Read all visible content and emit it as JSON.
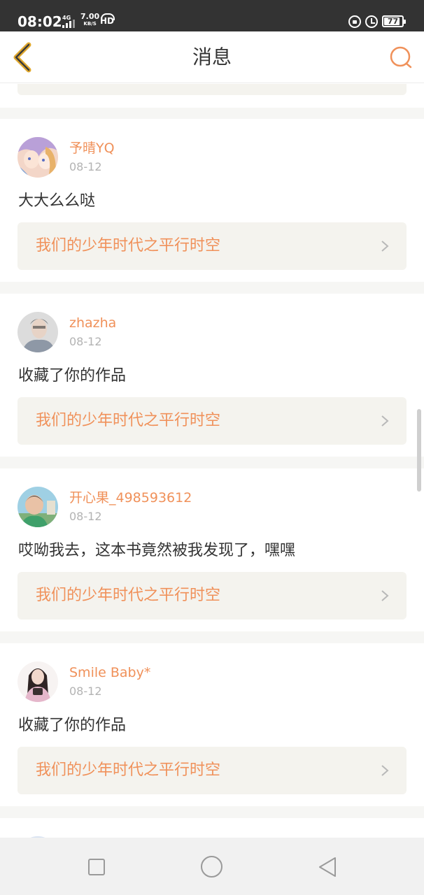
{
  "status_bar": {
    "time": "08:02",
    "network_type": "4G",
    "speed_value": "7.00",
    "speed_unit": "KB/S",
    "hd_label": "HD",
    "battery": "77",
    "icons": [
      "signal-icon",
      "hd-call-icon",
      "lock-rotation-icon",
      "alarm-icon",
      "battery-icon"
    ]
  },
  "header": {
    "title": "消息",
    "back_icon": "chevron-left-icon",
    "search_icon": "search-icon",
    "accent_color": "#f0915a"
  },
  "messages": [
    {
      "username": "予晴YQ",
      "date": "08-12",
      "text": "大大么么哒",
      "work_title": "我们的少年时代之平行时空"
    },
    {
      "username": "zhazha",
      "date": "08-12",
      "text": "收藏了你的作品",
      "work_title": "我们的少年时代之平行时空"
    },
    {
      "username": "开心果_498593612",
      "date": "08-12",
      "text": "哎呦我去，这本书竟然被我发现了，嘿嘿",
      "work_title": "我们的少年时代之平行时空"
    },
    {
      "username": "Smile Baby*",
      "date": "08-12",
      "text": "收藏了你的作品",
      "work_title": "我们的少年时代之平行时空"
    }
  ],
  "nav_bar": {
    "icons": [
      "recent-apps-icon",
      "home-icon",
      "back-icon"
    ]
  }
}
